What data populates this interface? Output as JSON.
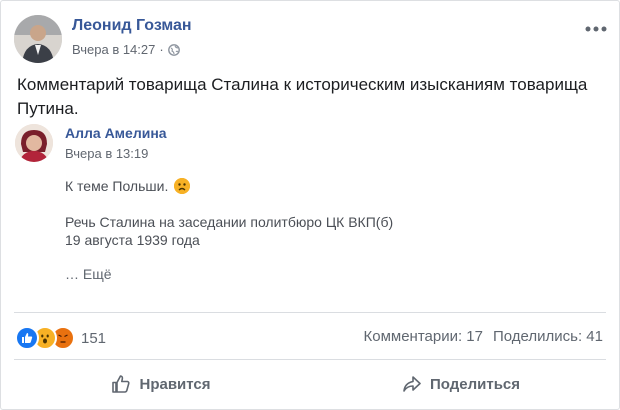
{
  "author": {
    "name": "Леонид Гозман",
    "time": "Вчера в 14:27",
    "privacy_icon": "globe-icon"
  },
  "post": {
    "text": "Комментарий товарища Сталина к историческим изысканиям товарища Путина."
  },
  "shared": {
    "name": "Алла Амелина",
    "time": "Вчера в 13:19",
    "line1": "К теме Польши.",
    "line1_emoji": "sad-face-icon",
    "line2": "Речь Сталина на заседании политбюро ЦК ВКП(б)",
    "line3": "19 августа 1939 года",
    "more": "… Ещё"
  },
  "engagement": {
    "reaction_icons": [
      "like-icon",
      "wow-icon",
      "angry-icon"
    ],
    "reaction_count": "151",
    "comments": "Комментарии: 17",
    "shares": "Поделились: 41"
  },
  "actions": {
    "like": "Нравится",
    "share": "Поделиться"
  },
  "colors": {
    "link_blue": "#385898",
    "like_blue": "#1877f2",
    "wow_yellow": "#f7b125",
    "angry_orange": "#e9710f",
    "muted_text": "#606770"
  }
}
